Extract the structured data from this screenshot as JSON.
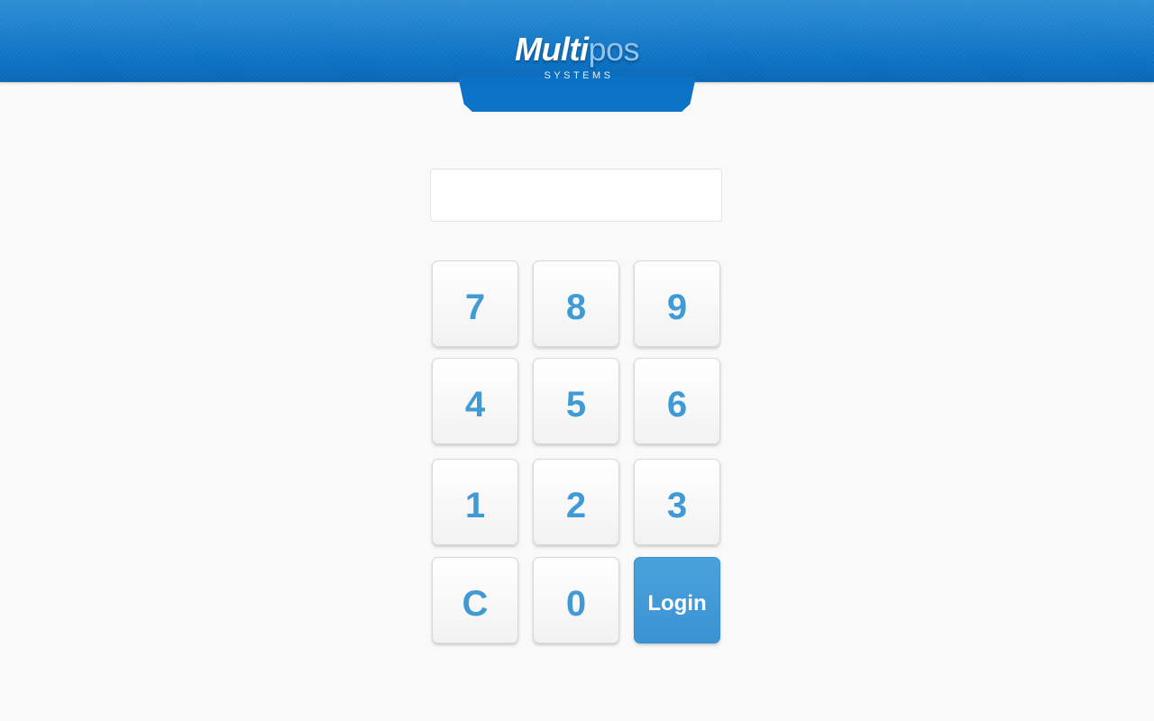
{
  "header": {
    "logo_bold": "Multi",
    "logo_light": "pos",
    "logo_subtitle": "SYSTEMS",
    "color_primary": "#0a72c6"
  },
  "pin_input": {
    "value": "",
    "placeholder": ""
  },
  "keypad": {
    "keys": [
      "7",
      "8",
      "9",
      "4",
      "5",
      "6",
      "1",
      "2",
      "3",
      "C",
      "0"
    ],
    "login_label": "Login",
    "key_text_color": "#3f9ad6",
    "login_color": "#3f9ad6"
  }
}
